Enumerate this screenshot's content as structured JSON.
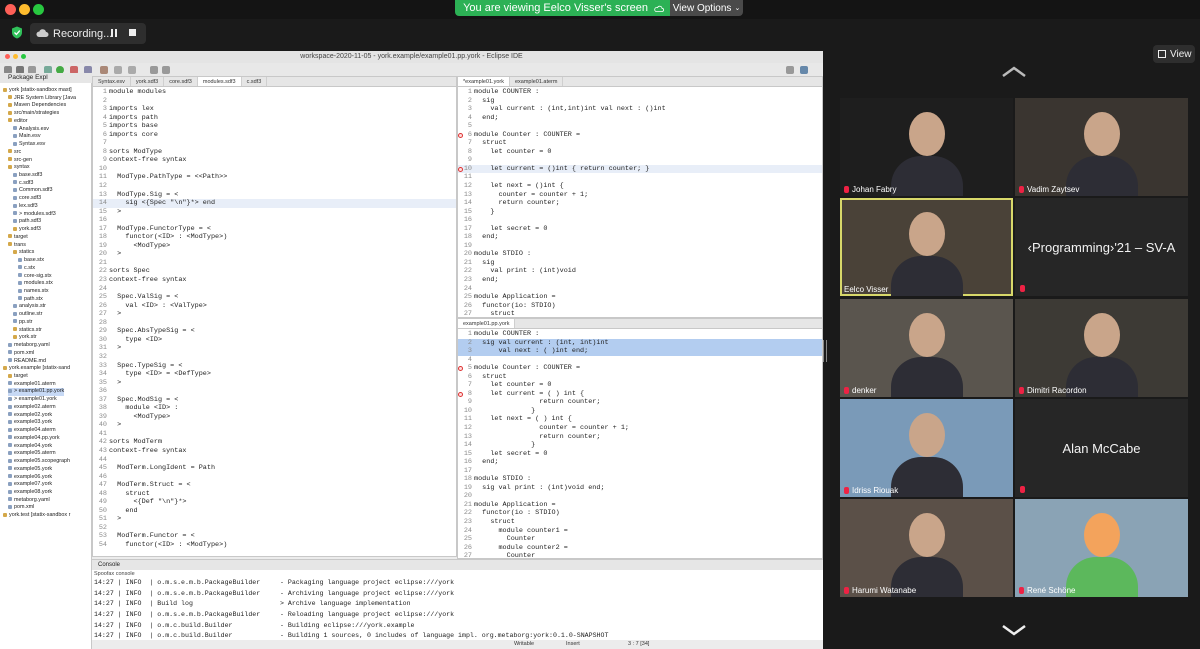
{
  "topbar": {
    "banner": "You are viewing Eelco Visser's screen",
    "view_options": "View Options"
  },
  "zoombar": {
    "recording": "Recording...",
    "view": "View"
  },
  "eclipse": {
    "title": "workspace-2020-11-05 - york.example/example01.pp.york - Eclipse IDE",
    "package_explorer": "Package Expl",
    "tree": [
      [
        "york [statix-sandbox mast]",
        0,
        "",
        0
      ],
      [
        "JRE System Library [Java",
        1,
        "",
        0
      ],
      [
        "Maven Dependencies",
        1,
        "",
        0
      ],
      [
        "src/main/strategies",
        1,
        "",
        0
      ],
      [
        "editor",
        1,
        "",
        0
      ],
      [
        "Analysis.esv",
        2,
        "",
        0
      ],
      [
        "Main.esv",
        2,
        "",
        0
      ],
      [
        "Syntax.esv",
        2,
        "",
        0
      ],
      [
        "src",
        1,
        "",
        0
      ],
      [
        "src-gen",
        1,
        "",
        0
      ],
      [
        "syntax",
        1,
        "",
        0
      ],
      [
        "base.sdf3",
        2,
        "",
        0
      ],
      [
        "c.sdf3",
        2,
        "",
        0
      ],
      [
        "Common.sdf3",
        2,
        "",
        0
      ],
      [
        "core.sdf3",
        2,
        "",
        0
      ],
      [
        "lex.sdf3",
        2,
        "",
        0
      ],
      [
        "> modules.sdf3",
        2,
        "",
        0
      ],
      [
        "path.sdf3",
        2,
        "",
        0
      ],
      [
        "york.sdf3",
        2,
        "",
        0
      ],
      [
        "target",
        1,
        "",
        0
      ],
      [
        "trans",
        1,
        "",
        0
      ],
      [
        "statics",
        2,
        "",
        0
      ],
      [
        "base.stx",
        3,
        "",
        0
      ],
      [
        "c.stx",
        3,
        "",
        0
      ],
      [
        "core-sig.stx",
        3,
        "",
        0
      ],
      [
        "modules.stx",
        3,
        "",
        0
      ],
      [
        "names.stx",
        3,
        "",
        0
      ],
      [
        "path.stx",
        3,
        "",
        0
      ],
      [
        "analysis.str",
        2,
        "",
        0
      ],
      [
        "outline.str",
        2,
        "",
        0
      ],
      [
        "pp.str",
        2,
        "",
        0
      ],
      [
        "statics.str",
        2,
        "",
        0
      ],
      [
        "york.str",
        2,
        "",
        0
      ],
      [
        "metaborg.yaml",
        1,
        "",
        0
      ],
      [
        "pom.xml",
        1,
        "",
        0
      ],
      [
        "README.md",
        1,
        "",
        0
      ],
      [
        "york.example [statix-sand",
        0,
        "",
        0
      ],
      [
        "target",
        1,
        "",
        0
      ],
      [
        "example01.aterm",
        1,
        "",
        0
      ],
      [
        "> example01.pp.york",
        1,
        "",
        1
      ],
      [
        "> example01.york",
        1,
        "",
        0
      ],
      [
        "example02.aterm",
        1,
        "",
        0
      ],
      [
        "example02.york",
        1,
        "",
        0
      ],
      [
        "example03.york",
        1,
        "",
        0
      ],
      [
        "example04.aterm",
        1,
        "",
        0
      ],
      [
        "example04.pp.york",
        1,
        "",
        0
      ],
      [
        "example04.york",
        1,
        "",
        0
      ],
      [
        "example05.aterm",
        1,
        "",
        0
      ],
      [
        "example05.scopegraph",
        1,
        "",
        0
      ],
      [
        "example05.york",
        1,
        "",
        0
      ],
      [
        "example06.york",
        1,
        "",
        0
      ],
      [
        "example07.york",
        1,
        "",
        0
      ],
      [
        "example08.york",
        1,
        "",
        0
      ],
      [
        "metaborg.yaml",
        1,
        "",
        0
      ],
      [
        "pom.xml",
        1,
        "",
        0
      ],
      [
        "york.test [statix-sandbox r",
        0,
        "",
        0
      ]
    ],
    "left_tabs": [
      "Syntax.esv",
      "york.sdf3",
      "core.sdf3",
      "modules.sdf3",
      "c.sdf3"
    ],
    "left_code": [
      [
        "1",
        "module modules"
      ],
      [
        "2",
        ""
      ],
      [
        "3",
        "imports lex"
      ],
      [
        "4",
        "imports path"
      ],
      [
        "5",
        "imports base"
      ],
      [
        "6",
        "imports core"
      ],
      [
        "7",
        ""
      ],
      [
        "8",
        "sorts ModType"
      ],
      [
        "9",
        "context-free syntax"
      ],
      [
        "10",
        ""
      ],
      [
        "11",
        "  ModType.PathType = <<Path>>"
      ],
      [
        "12",
        ""
      ],
      [
        "13",
        "  ModType.Sig = <"
      ],
      [
        "14",
        "    sig <{Spec \"\\n\"}*> end"
      ],
      [
        "15",
        "  >"
      ],
      [
        "16",
        ""
      ],
      [
        "17",
        "  ModType.FunctorType = <"
      ],
      [
        "18",
        "    functor(<ID> : <ModType>)"
      ],
      [
        "19",
        "      <ModType>"
      ],
      [
        "20",
        "  >"
      ],
      [
        "21",
        ""
      ],
      [
        "22",
        "sorts Spec"
      ],
      [
        "23",
        "context-free syntax"
      ],
      [
        "24",
        ""
      ],
      [
        "25",
        "  Spec.ValSig = <"
      ],
      [
        "26",
        "    val <ID> : <ValType>"
      ],
      [
        "27",
        "  >"
      ],
      [
        "28",
        ""
      ],
      [
        "29",
        "  Spec.AbsTypeSig = <"
      ],
      [
        "30",
        "    type <ID>"
      ],
      [
        "31",
        "  >"
      ],
      [
        "32",
        ""
      ],
      [
        "33",
        "  Spec.TypeSig = <"
      ],
      [
        "34",
        "    type <ID> = <DefType>"
      ],
      [
        "35",
        "  >"
      ],
      [
        "36",
        ""
      ],
      [
        "37",
        "  Spec.ModSig = <"
      ],
      [
        "38",
        "    module <ID> :"
      ],
      [
        "39",
        "      <ModType>"
      ],
      [
        "40",
        "  >"
      ],
      [
        "41",
        ""
      ],
      [
        "42",
        "sorts ModTerm"
      ],
      [
        "43",
        "context-free syntax"
      ],
      [
        "44",
        ""
      ],
      [
        "45",
        "  ModTerm.LongIdent = Path"
      ],
      [
        "46",
        ""
      ],
      [
        "47",
        "  ModTerm.Struct = <"
      ],
      [
        "48",
        "    struct"
      ],
      [
        "49",
        "      <{Def \"\\n\"}*>"
      ],
      [
        "50",
        "    end"
      ],
      [
        "51",
        "  >"
      ],
      [
        "52",
        ""
      ],
      [
        "53",
        "  ModTerm.Functor = <"
      ],
      [
        "54",
        "    functor(<ID> : <ModType>)"
      ]
    ],
    "right_tabs": [
      "*example01.york",
      "example01.aterm"
    ],
    "right_code": [
      [
        "1",
        "module COUNTER :"
      ],
      [
        "2",
        "  sig"
      ],
      [
        "3",
        "    val current : (int,int)int val next : ()int"
      ],
      [
        "4",
        "  end;"
      ],
      [
        "5",
        ""
      ],
      [
        "6",
        "module Counter : COUNTER ="
      ],
      [
        "7",
        "  struct"
      ],
      [
        "8",
        "    let counter = 0"
      ],
      [
        "9",
        ""
      ],
      [
        "10",
        "    let current = ()int { return counter; }"
      ],
      [
        "11",
        ""
      ],
      [
        "12",
        "    let next = ()int {"
      ],
      [
        "13",
        "      counter = counter + 1;"
      ],
      [
        "14",
        "      return counter;"
      ],
      [
        "15",
        "    }"
      ],
      [
        "16",
        ""
      ],
      [
        "17",
        "    let secret = 0"
      ],
      [
        "18",
        "  end;"
      ],
      [
        "19",
        ""
      ],
      [
        "20",
        "module STDIO :"
      ],
      [
        "21",
        "  sig"
      ],
      [
        "22",
        "    val print : (int)void"
      ],
      [
        "23",
        "  end;"
      ],
      [
        "24",
        ""
      ],
      [
        "25",
        "module Application ="
      ],
      [
        "26",
        "  functor(io: STDIO)"
      ],
      [
        "27",
        "    struct"
      ]
    ],
    "pp_tabs": [
      "example01.pp.york"
    ],
    "pp_code": [
      [
        "1",
        "module COUNTER :"
      ],
      [
        "2",
        "  sig val current : (int, int)int"
      ],
      [
        "3",
        "      val next : ( )int end;"
      ],
      [
        "4",
        ""
      ],
      [
        "5",
        "module Counter : COUNTER ="
      ],
      [
        "6",
        "  struct"
      ],
      [
        "7",
        "    let counter = 0"
      ],
      [
        "8",
        "    let current = ( ) int {"
      ],
      [
        "9",
        "                return counter;"
      ],
      [
        "10",
        "              }"
      ],
      [
        "11",
        "    let next = ( ) int {"
      ],
      [
        "12",
        "                counter = counter + 1;"
      ],
      [
        "13",
        "                return counter;"
      ],
      [
        "14",
        "              }"
      ],
      [
        "15",
        "    let secret = 0"
      ],
      [
        "16",
        "  end;"
      ],
      [
        "17",
        ""
      ],
      [
        "18",
        "module STDIO :"
      ],
      [
        "19",
        "  sig val print : (int)void end;"
      ],
      [
        "20",
        ""
      ],
      [
        "21",
        "module Application ="
      ],
      [
        "22",
        "  functor(io : STDIO)"
      ],
      [
        "23",
        "    struct"
      ],
      [
        "24",
        "      module counter1 ="
      ],
      [
        "25",
        "        Counter"
      ],
      [
        "26",
        "      module counter2 ="
      ],
      [
        "27",
        "        Counter"
      ]
    ],
    "console_tab": "Console",
    "console_sub": "Spoofax console",
    "console_lines": [
      "14:27 | INFO  | o.m.s.e.m.b.PackageBuilder     - Packaging language project eclipse:///york",
      "14:27 | INFO  | o.m.s.e.m.b.PackageBuilder     - Archiving language project eclipse:///york",
      "14:27 | INFO  | Build log                      > Archive language implementation",
      "14:27 | INFO  | o.m.s.e.m.b.PackageBuilder     - Reloading language project eclipse:///york",
      "14:27 | INFO  | o.m.c.build.Builder            - Building eclipse:///york.example",
      "14:27 | INFO  | o.m.c.build.Builder            - Building 1 sources, 0 includes of language impl. org.metaborg:york:0.1.0-SNAPSHOT"
    ],
    "status": {
      "writable": "Writable",
      "insert": "Insert",
      "pos": "3 : 7 [34]"
    }
  },
  "participants": [
    {
      "name": "Johan Fabry",
      "video": true
    },
    {
      "name": "Vadim Zaytsev",
      "video": true
    },
    {
      "name": "Eelco Visser",
      "video": true
    },
    {
      "name": "‹Programming›'21 – SV-A",
      "video": false
    },
    {
      "name": "denker",
      "video": true
    },
    {
      "name": "Dimitri Racordon",
      "video": true
    },
    {
      "name": "Idriss Riouak",
      "video": true
    },
    {
      "name": "Alan McCabe",
      "video": false
    },
    {
      "name": "Harumi Watanabe",
      "video": true
    },
    {
      "name": "René Schöne",
      "video": true
    }
  ],
  "colors": {
    "accent_active_speaker": "#d8d86a",
    "banner_green": "#2cb155",
    "muted_red": "#e24"
  }
}
